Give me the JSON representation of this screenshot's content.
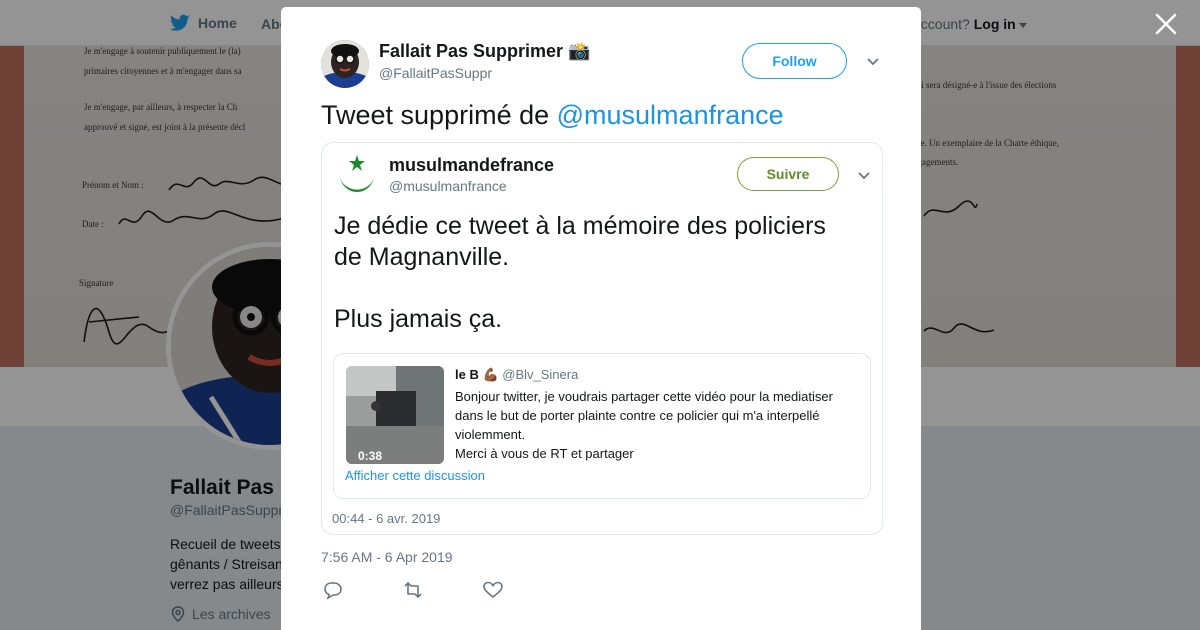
{
  "nav": {
    "home_label": "Home",
    "about_label": "Abo",
    "account_prefix": "account?",
    "login_label": "Log in"
  },
  "banner": {
    "lines": [
      "Je m'engage à soutenir publiquement le (la)",
      "primaires citoyennes et à m'engager dans sa",
      "Je m'engage, par ailleurs, à respecter la Ch",
      "approuvé et signé, est joint à la présente décl",
      "Prénom et Nom :",
      "Date :",
      "Signature",
      "e qui sera désigné-e à l'issue des élections",
      "e.",
      "ique. Un exemplaire de la Charte éthique,",
      "engagements."
    ]
  },
  "profile": {
    "name": "Fallait Pas",
    "handle": "@FallaitPasSuppr",
    "bio_lines": [
      "Recueil de tweets",
      "gênants / Streisan",
      "verrez pas ailleurs"
    ],
    "location": "Les archives"
  },
  "modal": {
    "author_name": "Fallait Pas Supprimer 📸",
    "author_handle": "@FallaitPasSuppr",
    "follow_label": "Follow",
    "tweet_text_prefix": "Tweet supprimé de ",
    "tweet_mention": "@musulmanfrance",
    "timestamp": "7:56 AM - 6 Apr 2019"
  },
  "embedded": {
    "name": "musulmandefrance",
    "handle": "@musulmanfrance",
    "follow_label": "Suivre",
    "text_lines": [
      "Je dédie ce tweet à la mémoire des policiers",
      "de Magnanville.",
      "",
      "Plus jamais ça."
    ],
    "date": "00:44 - 6 avr. 2019",
    "quote": {
      "name": "le B 💪🏾",
      "handle": "@Blv_Sinera",
      "video_duration": "0:38",
      "body_lines": [
        "Bonjour twitter, je voudrais partager cette vidéo pour la mediatiser",
        "dans le but de porter plainte contre ce policier qui m'a interpellé",
        "violemment.",
        "Merci à vous de RT et partager"
      ],
      "thread_link": "Afficher cette discussion"
    }
  },
  "colors": {
    "twitter_blue": "#1da1f2",
    "mention_blue": "#1b95e0",
    "suivre_green": "#5f8d27"
  },
  "icons": [
    "twitter-bird-icon",
    "close-icon",
    "chevron-down-icon",
    "reply-icon",
    "retweet-icon",
    "like-icon",
    "location-pin-icon",
    "crescent-star-logo-icon"
  ]
}
